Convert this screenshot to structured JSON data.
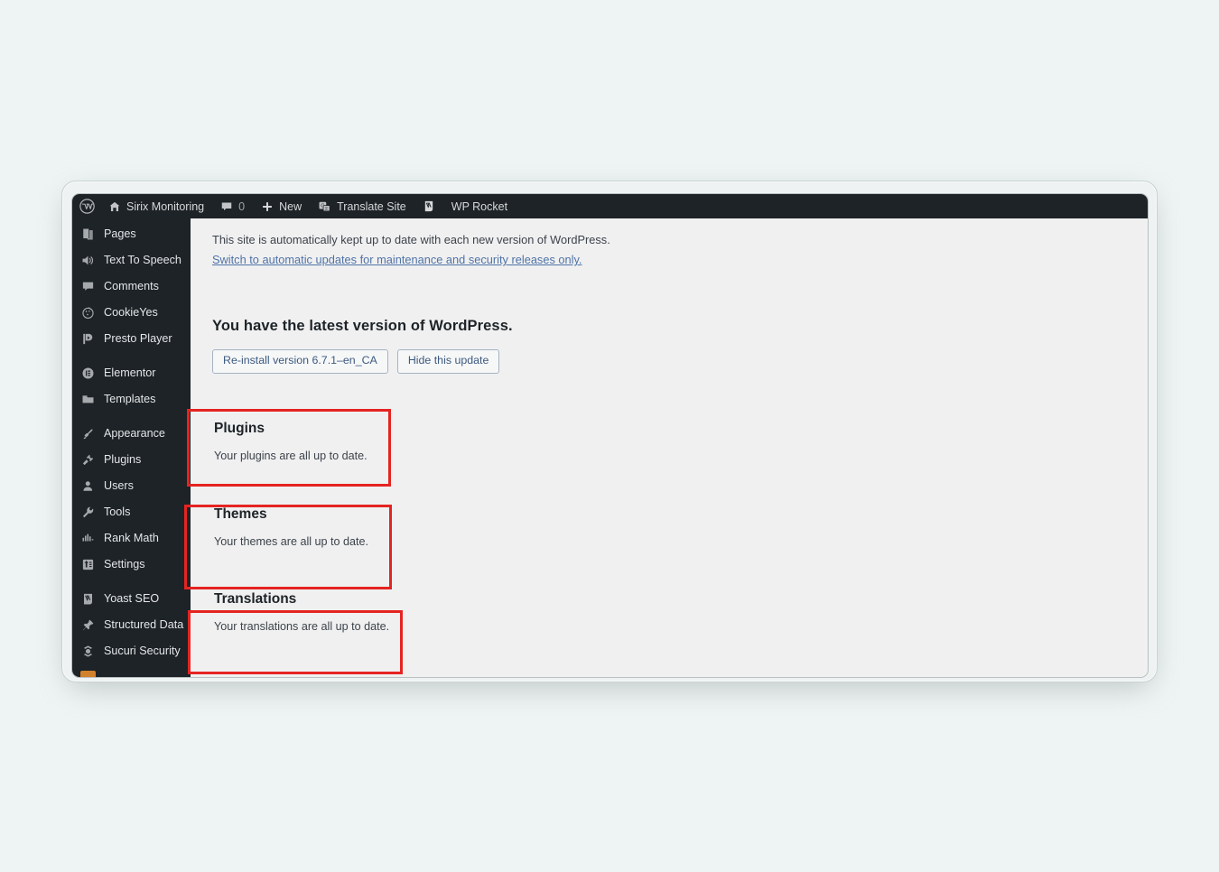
{
  "admin_bar": {
    "items": [
      {
        "icon": "wordpress-logo-icon",
        "label": ""
      },
      {
        "icon": "home-icon",
        "label": "Sirix Monitoring"
      },
      {
        "icon": "comment-bubble-icon",
        "label": "0"
      },
      {
        "icon": "plus-icon",
        "label": "New"
      },
      {
        "icon": "translate-icon",
        "label": "Translate Site"
      },
      {
        "icon": "yoast-icon",
        "label": ""
      },
      {
        "icon": "rocket-icon",
        "label": "WP Rocket"
      }
    ]
  },
  "sidebar": {
    "groups": [
      {
        "items": [
          {
            "icon": "pages-icon",
            "label": "Pages"
          },
          {
            "icon": "speaker-icon",
            "label": "Text To Speech"
          },
          {
            "icon": "comment-icon",
            "label": "Comments"
          },
          {
            "icon": "cookie-icon",
            "label": "CookieYes"
          },
          {
            "icon": "presto-player-icon",
            "label": "Presto Player"
          }
        ]
      },
      {
        "items": [
          {
            "icon": "elementor-icon",
            "label": "Elementor"
          },
          {
            "icon": "folder-icon",
            "label": "Templates"
          }
        ]
      },
      {
        "items": [
          {
            "icon": "brush-icon",
            "label": "Appearance"
          },
          {
            "icon": "plug-icon",
            "label": "Plugins"
          },
          {
            "icon": "users-icon",
            "label": "Users"
          },
          {
            "icon": "wrench-icon",
            "label": "Tools"
          },
          {
            "icon": "chart-icon",
            "label": "Rank Math"
          },
          {
            "icon": "settings-icon",
            "label": "Settings"
          }
        ]
      },
      {
        "items": [
          {
            "icon": "yoast-icon",
            "label": "Yoast SEO"
          },
          {
            "icon": "pin-icon",
            "label": "Structured Data"
          },
          {
            "icon": "sucuri-icon",
            "label": "Sucuri Security"
          }
        ]
      }
    ]
  },
  "content": {
    "auto_update_notice": "This site is automatically kept up to date with each new version of WordPress.",
    "auto_update_link": "Switch to automatic updates for maintenance and security releases only.",
    "latest_version_heading": "You have the latest version of WordPress.",
    "buttons": {
      "reinstall": "Re-install version 6.7.1–en_CA",
      "hide": "Hide this update"
    },
    "cards": [
      {
        "title": "Plugins",
        "description": "Your plugins are all up to date."
      },
      {
        "title": "Themes",
        "description": "Your themes are all up to date."
      },
      {
        "title": "Translations",
        "description": "Your translations are all up to date."
      }
    ]
  },
  "annotations": {
    "highlight_color": "#e52421",
    "boxes": [
      {
        "name": "plugins-highlight"
      },
      {
        "name": "themes-highlight"
      },
      {
        "name": "translations-highlight"
      }
    ]
  }
}
